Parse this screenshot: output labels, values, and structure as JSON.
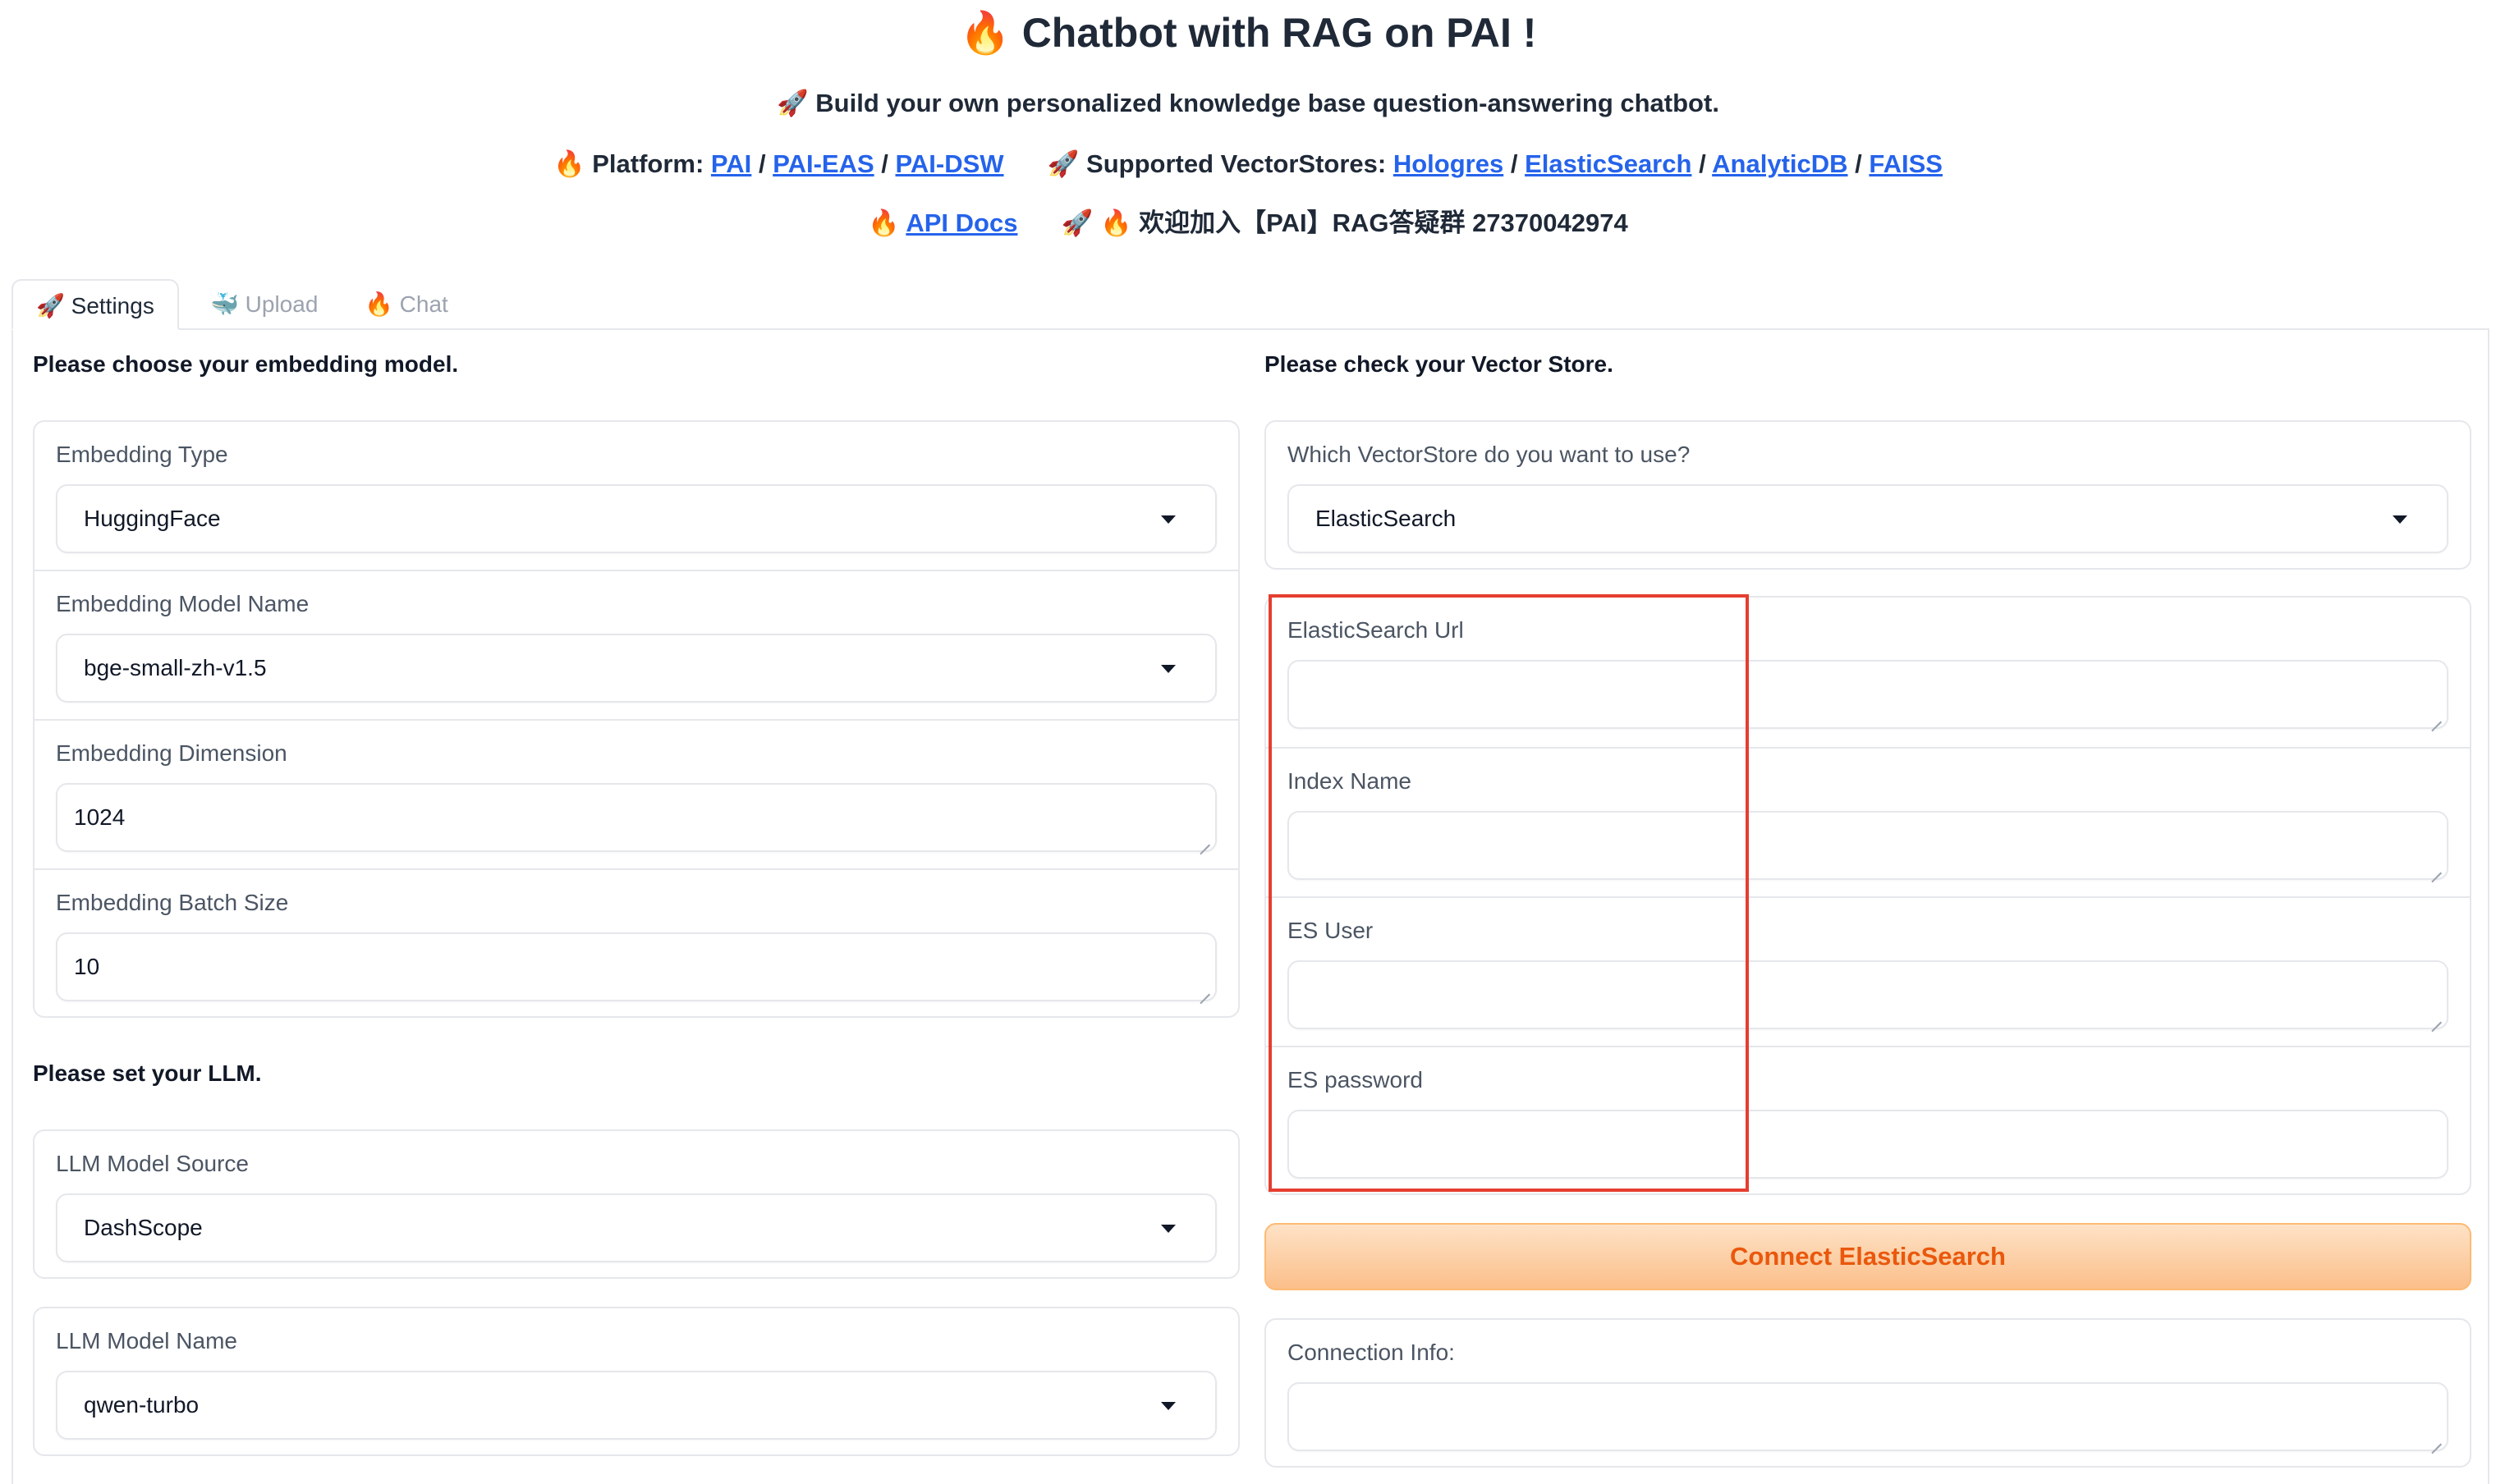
{
  "header": {
    "title": "Chatbot with RAG on PAI !",
    "subtitle": "Build your own personalized knowledge base question-answering chatbot.",
    "platform_label": "Platform:",
    "platform_links": [
      "PAI",
      "PAI-EAS",
      "PAI-DSW"
    ],
    "vectorstores_label": "Supported VectorStores:",
    "vectorstore_links": [
      "Hologres",
      "ElasticSearch",
      "AnalyticDB",
      "FAISS"
    ],
    "api_docs": "API Docs",
    "group_text": "欢迎加入【PAI】RAG答疑群 27370042974",
    "separator": "/"
  },
  "icons": {
    "fire": "🔥",
    "rocket": "🚀",
    "whale": "🐳"
  },
  "tabs": [
    {
      "label": "Settings",
      "icon": "rocket-icon",
      "active": true
    },
    {
      "label": "Upload",
      "icon": "whale-icon",
      "active": false
    },
    {
      "label": "Chat",
      "icon": "fire-icon",
      "active": false
    }
  ],
  "left": {
    "embedding_heading": "Please choose your embedding model.",
    "embedding_type": {
      "label": "Embedding Type",
      "value": "HuggingFace"
    },
    "embedding_model": {
      "label": "Embedding Model Name",
      "value": "bge-small-zh-v1.5"
    },
    "embedding_dim": {
      "label": "Embedding Dimension",
      "value": "1024"
    },
    "embedding_batch": {
      "label": "Embedding Batch Size",
      "value": "10"
    },
    "llm_heading": "Please set your LLM.",
    "llm_source": {
      "label": "LLM Model Source",
      "value": "DashScope"
    },
    "llm_name": {
      "label": "LLM Model Name",
      "value": "qwen-turbo"
    }
  },
  "right": {
    "vector_heading": "Please check your Vector Store.",
    "vectorstore": {
      "label": "Which VectorStore do you want to use?",
      "value": "ElasticSearch"
    },
    "es_url": {
      "label": "ElasticSearch Url",
      "value": ""
    },
    "index_name": {
      "label": "Index Name",
      "value": ""
    },
    "es_user": {
      "label": "ES User",
      "value": ""
    },
    "es_password": {
      "label": "ES password",
      "value": ""
    },
    "connect_button": "Connect ElasticSearch",
    "connection_info": {
      "label": "Connection Info:",
      "value": ""
    }
  },
  "colors": {
    "accent_link": "#2563eb",
    "button_text": "#ea580c",
    "highlight": "#e53e30"
  }
}
